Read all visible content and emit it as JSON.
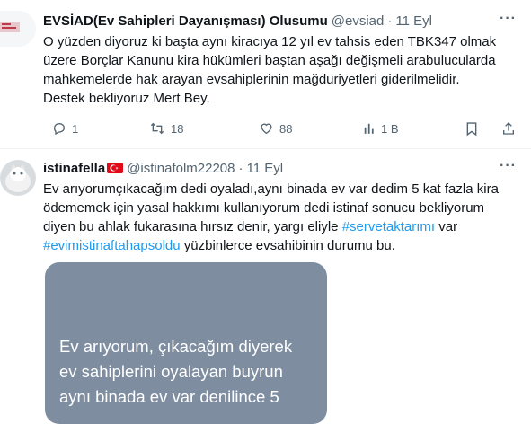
{
  "tweet1": {
    "name": "EVSİAD(Ev Sahipleri Dayanışması) Olusumu",
    "handle": "@evsiad",
    "dot": "·",
    "time": "11 Eyl",
    "more": "···",
    "lines": [
      "O yüzden diyoruz ki başta aynı kiracıya 12 yıl ev tahsis eden TBK347 olmak",
      "üzere Borçlar Kanunu kira hükümleri baştan aşağı değişmeli arabulucularda",
      "mahkemelerde hak arayan evsahiplerinin mağduriyetleri giderilmelidir.",
      "Destek bekliyoruz Mert Bey."
    ],
    "actions": {
      "replies": "1",
      "retweets": "18",
      "likes": "88",
      "views": "1 B"
    }
  },
  "tweet2": {
    "name": "istinafella",
    "handle": "@istinafolm22208",
    "dot": "·",
    "time": "11 Eyl",
    "more": "···",
    "line1": "Ev arıyorumçıkacağım dedi oyaladı,aynı binada ev var dedim 5 kat fazla kira",
    "line2": "ödememek için yasal hakkımı kullanıyorum dedi istinaf sonucu bekliyorum",
    "line3_pre": "diyen bu ahlak fukarasına hırsız denir, yargı eliyle ",
    "hashtag1": "#servetaktarımı",
    "line3_post": " var",
    "hashtag2": "#evimistinaftahapsoldu",
    "line4_post": " yüzbinlerce evsahibinin durumu bu.",
    "media_lines": [
      "Ev arıyorum, çıkacağım diyerek",
      "ev sahiplerini oyalayan buyrun",
      "aynı binada ev var denilince 5"
    ]
  },
  "colors": {
    "accent": "#1d9bf0",
    "muted": "#536471",
    "text": "#0f1419",
    "media_bg": "#7f8da0",
    "flag_red": "#e30a17"
  }
}
